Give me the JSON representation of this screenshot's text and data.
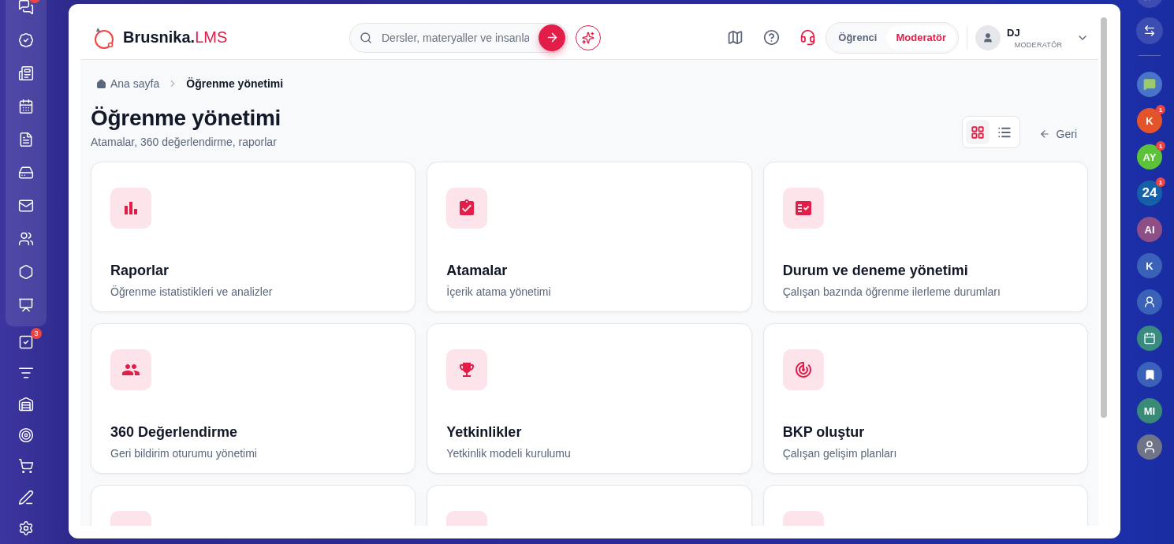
{
  "left_rail": {
    "items": [
      {
        "badge_dot": true,
        "grouped": true
      },
      {
        "grouped": true
      },
      {
        "grouped": true
      },
      {
        "grouped": true
      },
      {
        "grouped": true
      },
      {
        "grouped": true
      },
      {
        "grouped": true
      },
      {
        "grouped": true
      },
      {
        "grouped": true
      },
      {
        "grouped": true
      },
      {
        "grouped": false,
        "badge": "3"
      },
      {
        "grouped": false
      },
      {
        "grouped": false
      },
      {
        "grouped": false
      },
      {
        "grouped": false
      },
      {
        "grouped": false
      },
      {
        "grouped": false
      }
    ]
  },
  "header": {
    "logo": {
      "name": "Brusnika.",
      "accent": "LMS"
    },
    "search": {
      "placeholder": "Dersler, materyaller ve insanla"
    },
    "roles": [
      {
        "label": "Öğrenci",
        "selected": false
      },
      {
        "label": "Moderatör",
        "selected": true
      }
    ],
    "user": {
      "initials": "DJ",
      "role": "MODERATÖR"
    }
  },
  "breadcrumbs": [
    {
      "label": "Ana sayfa",
      "current": false
    },
    {
      "label": "Öğrenme yönetimi",
      "current": true
    }
  ],
  "page": {
    "title": "Öğrenme yönetimi",
    "subtitle": "Atamalar, 360 değerlendirme, raporlar",
    "views": [
      {
        "kind": "grid",
        "selected": true
      },
      {
        "kind": "list",
        "selected": false
      }
    ],
    "back": "Geri"
  },
  "cards": [
    {
      "kind": "full",
      "title": "Raporlar",
      "subtitle": "Öğrenme istatistikleri ve analizler"
    },
    {
      "kind": "full",
      "title": "Atamalar",
      "subtitle": "İçerik atama yönetimi"
    },
    {
      "kind": "full",
      "title": "Durum ve deneme yönetimi",
      "subtitle": "Çalışan bazında öğrenme ilerleme durumları"
    },
    {
      "kind": "full",
      "title": "360 Değerlendirme",
      "subtitle": "Geri bildirim oturumu yönetimi"
    },
    {
      "kind": "full",
      "title": "Yetkinlikler",
      "subtitle": "Yetkinlik modeli kurulumu"
    },
    {
      "kind": "full",
      "title": "BKP oluştur",
      "subtitle": "Çalışan gelişim planları"
    },
    {
      "kind": "partial"
    },
    {
      "kind": "partial"
    },
    {
      "kind": "partial"
    }
  ],
  "right_rail": {
    "contacts": [
      {
        "kind": "chat",
        "color": "#4a74c8"
      },
      {
        "kind": "initials",
        "text": "K",
        "badge": "1",
        "color": "#e4542a"
      },
      {
        "kind": "initials",
        "text": "AY",
        "badge": "1",
        "color": "#5cc23a"
      },
      {
        "kind": "initials",
        "text": "24",
        "badge": "1",
        "color": "#1561a8"
      },
      {
        "kind": "initials",
        "text": "AI",
        "color": "#8e4f86"
      },
      {
        "kind": "initials",
        "text": "K",
        "color": "#3a62b8"
      },
      {
        "kind": "person",
        "color": "#3a62b8"
      },
      {
        "kind": "calendar",
        "color": "#3a8a80"
      },
      {
        "kind": "bookmark",
        "color": "#3a62b8"
      },
      {
        "kind": "initials",
        "text": "MI",
        "color": "#3a8a78"
      },
      {
        "kind": "avatar",
        "color": "#6f7487"
      }
    ]
  }
}
